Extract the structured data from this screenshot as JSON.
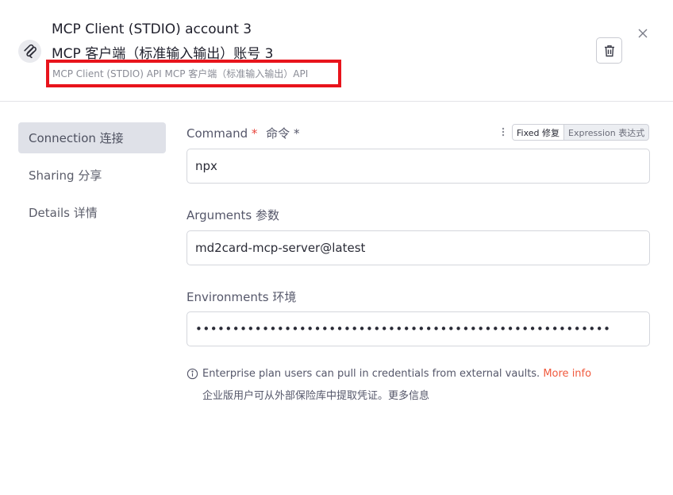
{
  "header": {
    "title_en": "MCP Client (STDIO) account 3",
    "title_zh": "MCP 客户端（标准输入输出）账号 3",
    "subtitle": "MCP Client (STDIO) API  MCP 客户端（标准输入输出）API",
    "app_icon": "mcp-logo-icon",
    "delete_icon": "trash-icon",
    "close_icon": "close-icon"
  },
  "sidebar": {
    "items": [
      {
        "label": "Connection  连接",
        "active": true
      },
      {
        "label": "Sharing  分享",
        "active": false
      },
      {
        "label": "Details  详情",
        "active": false
      }
    ]
  },
  "form": {
    "command": {
      "label": "Command",
      "required_mark": "*",
      "label_zh": "命令 *",
      "value": "npx",
      "mode_fixed": "Fixed  修复",
      "mode_expression": "Expression  表达式"
    },
    "arguments": {
      "label": "Arguments   参数",
      "value": "md2card-mcp-server@latest"
    },
    "environments": {
      "label": "Environments   环境",
      "value": "••••••••••••••••••••••••••••••••••••••••••••••••••••••••"
    },
    "info": {
      "text_en": "Enterprise plan users can pull in credentials from external vaults. ",
      "link": "More info",
      "text_zh": "企业版用户可从外部保险库中提取凭证。更多信息"
    }
  },
  "colors": {
    "accent_required": "#e8453c",
    "link": "#f05a3e",
    "highlight_box": "#e8141c",
    "active_nav_bg": "#dfe1e8"
  }
}
